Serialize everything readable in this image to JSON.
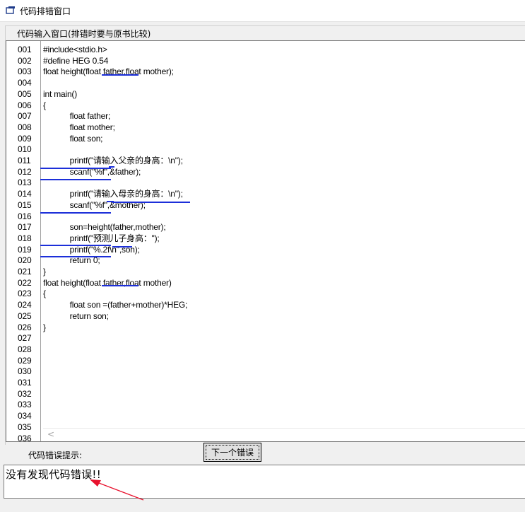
{
  "window": {
    "title": "代码排错窗口"
  },
  "editor": {
    "group_label": "代码输入窗口(排错时要与原书比较)",
    "lines": [
      {
        "n": "001",
        "code": "#include<stdio.h>"
      },
      {
        "n": "002",
        "code": "#define HEG 0.54"
      },
      {
        "n": "003",
        "code": "float height(float father,float mother);"
      },
      {
        "n": "004",
        "code": ""
      },
      {
        "n": "005",
        "code": "int main()"
      },
      {
        "n": "006",
        "code": "{"
      },
      {
        "n": "007",
        "code": "            float father;"
      },
      {
        "n": "008",
        "code": "            float mother;"
      },
      {
        "n": "009",
        "code": "            float son;"
      },
      {
        "n": "010",
        "code": ""
      },
      {
        "n": "011",
        "code": "            printf(\"请输入父亲的身高：\\n\");"
      },
      {
        "n": "012",
        "code": "            scanf(\"%f\",&father);"
      },
      {
        "n": "013",
        "code": ""
      },
      {
        "n": "014",
        "code": "            printf(\"请输入母亲的身高：\\n\");"
      },
      {
        "n": "015",
        "code": "            scanf(\"%f\",&mother);"
      },
      {
        "n": "016",
        "code": ""
      },
      {
        "n": "017",
        "code": "            son=height(father,mother);"
      },
      {
        "n": "018",
        "code": "            printf(\"预测儿子身高：\");"
      },
      {
        "n": "019",
        "code": "            printf(\"%.2f\\n\",son);"
      },
      {
        "n": "020",
        "code": "            return 0;"
      },
      {
        "n": "021",
        "code": "}"
      },
      {
        "n": "022",
        "code": "float height(float father,float mother)"
      },
      {
        "n": "023",
        "code": "{"
      },
      {
        "n": "024",
        "code": "            float son =(father+mother)*HEG;"
      },
      {
        "n": "025",
        "code": "            return son;"
      },
      {
        "n": "026",
        "code": "}"
      },
      {
        "n": "027",
        "code": ""
      },
      {
        "n": "028",
        "code": ""
      },
      {
        "n": "029",
        "code": ""
      },
      {
        "n": "030",
        "code": ""
      },
      {
        "n": "031",
        "code": ""
      },
      {
        "n": "032",
        "code": ""
      },
      {
        "n": "033",
        "code": ""
      },
      {
        "n": "034",
        "code": ""
      },
      {
        "n": "035",
        "code": ""
      },
      {
        "n": "036",
        "code": ""
      }
    ],
    "scroll_left_glyph": "<"
  },
  "errors": {
    "hint_label": "代码错误提示:",
    "next_button_label": "下一个错误",
    "message": "没有发现代码错误!!"
  },
  "colors": {
    "underline": "#1c2fd9",
    "arrow": "#e8112d"
  }
}
